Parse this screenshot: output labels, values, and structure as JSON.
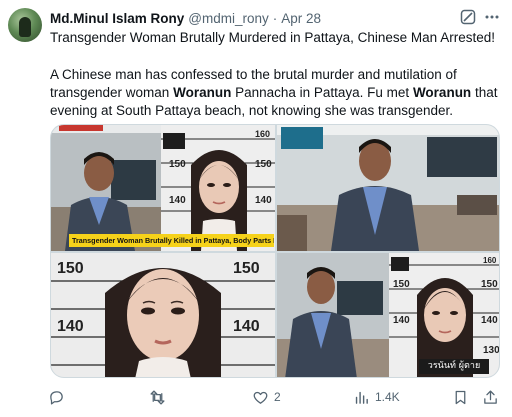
{
  "author": {
    "name": "Md.Minul Islam Rony",
    "handle": "@mdmi_rony",
    "separator": "·",
    "date": "Apr 28"
  },
  "post": {
    "title": "Transgender Woman Brutally Murdered in Pattaya, Chinese Man Arrested!",
    "body_1": "A Chinese man has confessed to the brutal murder and mutilation of transgender woman ",
    "body_name_1": "Woranun",
    "body_2": " Pannacha in Pattaya. Fu met ",
    "body_name_2": "Woranun",
    "body_3": " that evening at South Pattaya beach, not knowing she was transgender."
  },
  "media": {
    "caption_1": "Transgender Woman Brutally Killed in Pattaya, Body Parts Removed",
    "caption_thai": "วรนันท์ ผู้ตาย",
    "height_marks_1": [
      "160",
      "150",
      "140",
      "130"
    ],
    "height_marks_3": [
      "150",
      "150",
      "140",
      "140"
    ],
    "height_marks_4": [
      "160",
      "150",
      "150",
      "140",
      "140",
      "130"
    ]
  },
  "actions": {
    "reply_count": "",
    "retweet_count": "",
    "like_count": "2",
    "views_count": "1.4K"
  },
  "icons": {
    "grok": "grok-icon",
    "more": "more-icon",
    "reply": "reply-icon",
    "retweet": "retweet-icon",
    "like": "heart-icon",
    "views": "views-icon",
    "bookmark": "bookmark-icon",
    "share": "share-icon"
  },
  "colors": {
    "text": "#0f1419",
    "secondary": "#536471",
    "caption_bg": "#f6d21a"
  }
}
